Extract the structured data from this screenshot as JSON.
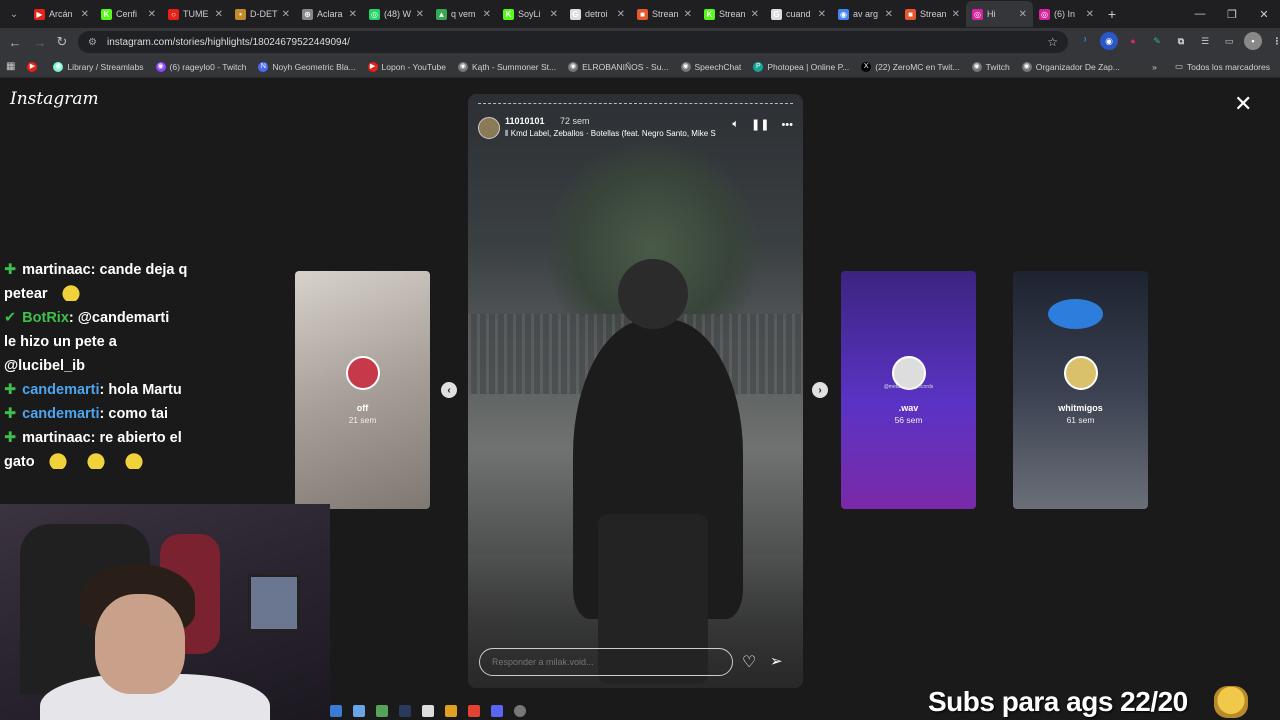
{
  "browser": {
    "tabs": [
      {
        "label": "Arcán",
        "color": "#e62117",
        "glyph": "▶"
      },
      {
        "label": "Cenfi",
        "color": "#53fc18",
        "glyph": "K"
      },
      {
        "label": "TUME",
        "color": "#e62117",
        "glyph": "○"
      },
      {
        "label": "D-DET",
        "color": "#c48a2b",
        "glyph": "•"
      },
      {
        "label": "Aclara",
        "color": "#888888",
        "glyph": "⊛"
      },
      {
        "label": "(48) W",
        "color": "#25d366",
        "glyph": "◎"
      },
      {
        "label": "q vem",
        "color": "#34a853",
        "glyph": "▲"
      },
      {
        "label": "SoyLi",
        "color": "#53fc18",
        "glyph": "K"
      },
      {
        "label": "detroi",
        "color": "#dddddd",
        "glyph": "G"
      },
      {
        "label": "Strean",
        "color": "#e8572c",
        "glyph": "■"
      },
      {
        "label": "Strean",
        "color": "#53fc18",
        "glyph": "K"
      },
      {
        "label": "cuand",
        "color": "#dddddd",
        "glyph": "G"
      },
      {
        "label": "av arg",
        "color": "#4285f4",
        "glyph": "◉"
      },
      {
        "label": "Strean",
        "color": "#e8572c",
        "glyph": "■"
      },
      {
        "label": "Hi",
        "color": "#d6249f",
        "glyph": "◎"
      },
      {
        "label": "(6) In",
        "color": "#d6249f",
        "glyph": "◎"
      }
    ],
    "active_tab_index": 14,
    "url": "instagram.com/stories/highlights/18024679522449094/",
    "bookmarks": [
      {
        "label": "",
        "color": "#e62117",
        "glyph": "▶"
      },
      {
        "label": "Library / Streamlabs",
        "color": "#80f5d2",
        "glyph": "◉"
      },
      {
        "label": "(6) rageylo0 - Twitch",
        "color": "#9146ff",
        "glyph": "◉"
      },
      {
        "label": "Noyh Geometric Bla...",
        "color": "#4a6cf7",
        "glyph": "N"
      },
      {
        "label": "Lopon - YouTube",
        "color": "#e62117",
        "glyph": "▶"
      },
      {
        "label": "Kąth - Summoner St...",
        "color": "#777777",
        "glyph": "◉"
      },
      {
        "label": "ELROBANIÑOS - Su...",
        "color": "#777777",
        "glyph": "◉"
      },
      {
        "label": "SpeechChat",
        "color": "#777777",
        "glyph": "◉"
      },
      {
        "label": "Photopea | Online P...",
        "color": "#18a497",
        "glyph": "P"
      },
      {
        "label": "(22) ZeroMC en Twit...",
        "color": "#000000",
        "glyph": "X"
      },
      {
        "label": "Twitch",
        "color": "#777777",
        "glyph": "◉"
      },
      {
        "label": "Organizador De Zap...",
        "color": "#777777",
        "glyph": "◉"
      }
    ],
    "bookmarks_right": "Todos los marcadores"
  },
  "instagram": {
    "logo": "Instagram",
    "story": {
      "username": "11010101",
      "age": "72 sem",
      "music": "Kmd Label, Zeballos · Botellas (feat. Negro Santo, Mike S",
      "reply_placeholder": "Responder a milak.void..."
    },
    "thumbnails": [
      {
        "name": "off",
        "age": "21 sem",
        "caption": "",
        "bg": "#bdb6b0",
        "avatar": "#c6394a"
      },
      {
        "name": ".wav",
        "age": "56 sem",
        "caption": "@metan_____records",
        "bg": "#4c2a9e",
        "avatar": "#dddddd"
      },
      {
        "name": "whitmigos",
        "age": "61 sem",
        "caption": "",
        "bg": "#2a2e3a",
        "avatar": "#d9c06a"
      }
    ]
  },
  "overlay": {
    "chat": [
      {
        "user": "martinaac",
        "text": ": cande deja q",
        "user_color": "#ffffff",
        "badge": "✚"
      },
      {
        "user": "",
        "text": "petear",
        "user_color": "#ffffff",
        "badge": ""
      },
      {
        "user": "BotRix",
        "text": ": @candemarti",
        "user_color": "#3fc04c",
        "badge": "✔"
      },
      {
        "user": "",
        "text": "le hizo un pete a",
        "user_color": "#ffffff",
        "badge": ""
      },
      {
        "user": "",
        "text": "@lucibel_ib",
        "user_color": "#ffffff",
        "badge": ""
      },
      {
        "user": "candemarti",
        "text": ": hola Martu",
        "user_color": "#4ca4f0",
        "badge": "✚"
      },
      {
        "user": "candemarti",
        "text": ": como tai",
        "user_color": "#4ca4f0",
        "badge": "✚"
      },
      {
        "user": "martinaac",
        "text": ": re abierto el",
        "user_color": "#ffffff",
        "badge": "✚"
      },
      {
        "user": "",
        "text": "gato",
        "user_color": "#ffffff",
        "badge": ""
      }
    ],
    "subs_goal": "Subs para ags 22/20"
  }
}
